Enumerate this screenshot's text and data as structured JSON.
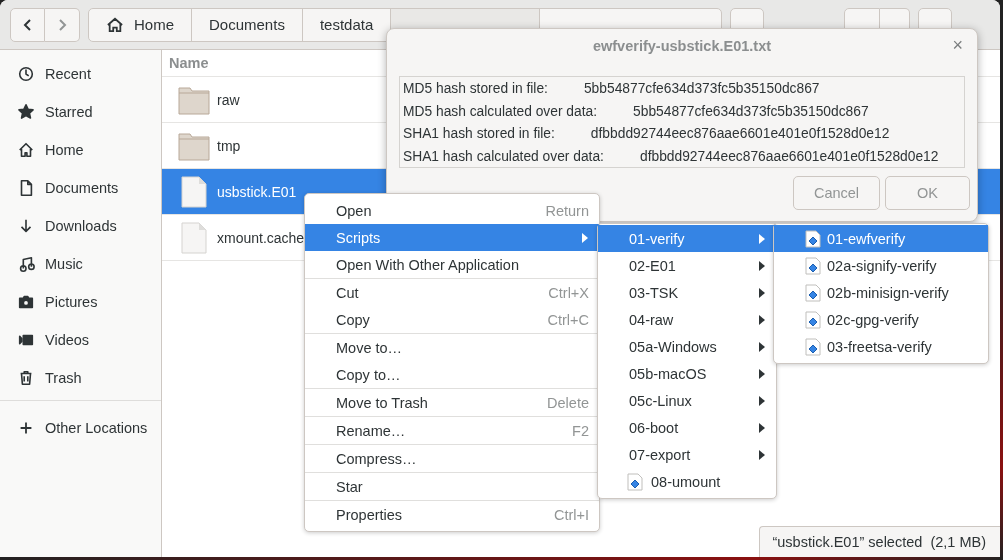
{
  "header": {
    "back_disabled": false,
    "forward_disabled": true,
    "path": [
      "Home",
      "Documents",
      "testdata"
    ]
  },
  "sidebar": {
    "items": [
      {
        "label": "Recent"
      },
      {
        "label": "Starred"
      },
      {
        "label": "Home"
      },
      {
        "label": "Documents"
      },
      {
        "label": "Downloads"
      },
      {
        "label": "Music"
      },
      {
        "label": "Pictures"
      },
      {
        "label": "Videos"
      },
      {
        "label": "Trash"
      }
    ],
    "other": "Other Locations"
  },
  "files": {
    "column": "Name",
    "rows": [
      {
        "name": "raw",
        "kind": "folder",
        "selected": false
      },
      {
        "name": "tmp",
        "kind": "folder",
        "selected": false
      },
      {
        "name": "usbstick.E01",
        "kind": "file",
        "selected": true
      },
      {
        "name": "xmount.cache",
        "kind": "file",
        "selected": false
      }
    ]
  },
  "context_menu": {
    "sections": [
      [
        {
          "label": "Open",
          "shortcut": "Return",
          "submenu": false,
          "selected": false
        },
        {
          "label": "Scripts",
          "submenu": true,
          "selected": true
        },
        {
          "label": "Open With Other Application",
          "submenu": false,
          "selected": false
        }
      ],
      [
        {
          "label": "Cut",
          "shortcut": "Ctrl+X",
          "submenu": false,
          "selected": false
        },
        {
          "label": "Copy",
          "shortcut": "Ctrl+C",
          "submenu": false,
          "selected": false
        }
      ],
      [
        {
          "label": "Move to…",
          "submenu": false,
          "selected": false
        },
        {
          "label": "Copy to…",
          "submenu": false,
          "selected": false
        }
      ],
      [
        {
          "label": "Move to Trash",
          "shortcut": "Delete",
          "submenu": false,
          "selected": false
        }
      ],
      [
        {
          "label": "Rename…",
          "shortcut": "F2",
          "submenu": false,
          "selected": false
        }
      ],
      [
        {
          "label": "Compress…",
          "submenu": false,
          "selected": false
        }
      ],
      [
        {
          "label": "Star",
          "submenu": false,
          "selected": false
        }
      ],
      [
        {
          "label": "Properties",
          "shortcut": "Ctrl+I",
          "submenu": false,
          "selected": false
        }
      ]
    ]
  },
  "scripts_menu": [
    {
      "label": "01-verify",
      "kind": "folder",
      "selected": true
    },
    {
      "label": "02-E01",
      "kind": "folder",
      "selected": false
    },
    {
      "label": "03-TSK",
      "kind": "folder",
      "selected": false
    },
    {
      "label": "04-raw",
      "kind": "folder",
      "selected": false
    },
    {
      "label": "05a-Windows",
      "kind": "folder",
      "selected": false
    },
    {
      "label": "05b-macOS",
      "kind": "folder",
      "selected": false
    },
    {
      "label": "05c-Linux",
      "kind": "folder",
      "selected": false
    },
    {
      "label": "06-boot",
      "kind": "folder",
      "selected": false
    },
    {
      "label": "07-export",
      "kind": "folder",
      "selected": false
    },
    {
      "label": "08-umount",
      "kind": "script",
      "selected": false
    }
  ],
  "verify_menu": [
    {
      "label": "01-ewfverify",
      "kind": "script",
      "selected": true
    },
    {
      "label": "02a-signify-verify",
      "kind": "script",
      "selected": false
    },
    {
      "label": "02b-minisign-verify",
      "kind": "script",
      "selected": false
    },
    {
      "label": "02c-gpg-verify",
      "kind": "script",
      "selected": false
    },
    {
      "label": "03-freetsa-verify",
      "kind": "script",
      "selected": false
    }
  ],
  "dialog": {
    "title": "ewfverify-usbstick.E01.txt",
    "close": "×",
    "rows": [
      {
        "label": "MD5 hash stored in file:",
        "value": "5bb54877cfe634d373fc5b35150dc867"
      },
      {
        "label": "MD5 hash calculated over data:",
        "value": "5bb54877cfe634d373fc5b35150dc867"
      },
      {
        "label": "SHA1 hash stored in file:",
        "value": "dfbbdd92744eec876aae6601e401e0f1528d0e12"
      },
      {
        "label": "SHA1 hash calculated over data:",
        "value": "dfbbdd92744eec876aae6601e401e0f1528d0e12"
      }
    ],
    "buttons": [
      {
        "label": "Cancel",
        "disabled": true
      },
      {
        "label": "OK",
        "disabled": true
      }
    ]
  },
  "status": "“usbstick.E01” selected  (2,1 MB)"
}
